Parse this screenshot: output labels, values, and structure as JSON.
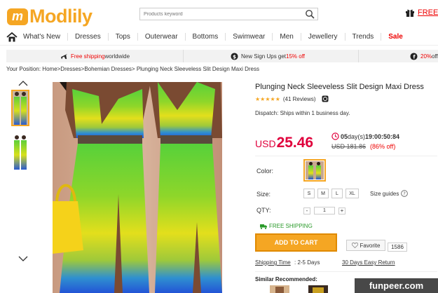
{
  "header": {
    "logo_mark": "m",
    "logo_text": "Modlily",
    "search_placeholder": "Products keyword",
    "gift_text": "FREE"
  },
  "nav": {
    "items": [
      "What's New",
      "Dresses",
      "Tops",
      "Outerwear",
      "Bottoms",
      "Swimwear",
      "Men",
      "Jewellery",
      "Trends",
      "Sale"
    ]
  },
  "promo": {
    "free_shipping_red": "Free shipping",
    "free_shipping_rest": " worldwide",
    "signup_pre": "New Sign Ups get ",
    "signup_red": "15% off",
    "third_red": "20%",
    "third_rest": " off"
  },
  "breadcrumb": {
    "prefix": "Your Position: ",
    "path": "Home>Dresses>Bohemian Dresses> ",
    "current": "Plunging Neck Sleeveless Slit Design Maxi Dress"
  },
  "product": {
    "title": "Plunging Neck Sleeveless Slit Design Maxi Dress",
    "stars": "★★★★★",
    "rating_level": 5,
    "reviews": "(41 Reviews)",
    "dispatch": "Dispatch: Ships within 1 business day.",
    "currency": "USD",
    "price": "25.46",
    "timer_days": "05",
    "timer_days_label": "day(s) ",
    "timer_time": "19:00:50:84",
    "old_price": "USD 181.86",
    "discount": "(86% off)",
    "color_label": "Color:",
    "size_label": "Size:",
    "sizes": [
      "S",
      "M",
      "L",
      "XL"
    ],
    "size_guide": "Size guides",
    "qty_label": "QTY:",
    "qty_minus": "-",
    "qty_value": "1",
    "qty_plus": "+",
    "free_shipping": "FREE SHIPPING",
    "add_to_cart": "ADD TO CART",
    "favorite": "Favorite",
    "favorite_count": "1586",
    "shipping_time": "Shipping Time",
    "shipping_time_value": ": 2-5 Days",
    "returns": "30 Days Easy Return",
    "similar": "Similar Recommended:"
  },
  "watermark": "funpeer.com",
  "colors": {
    "accent": "#f5a623",
    "sale_red": "#e0003c",
    "green_ok": "#2a9a2a"
  }
}
